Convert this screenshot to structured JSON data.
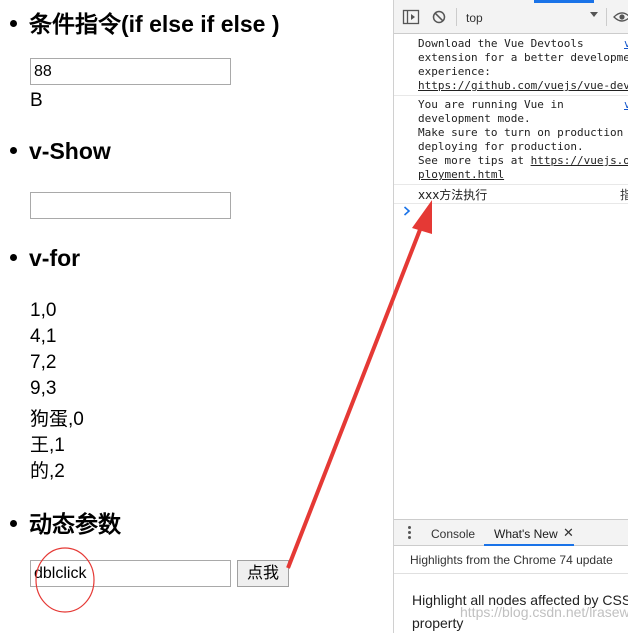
{
  "page": {
    "sections": [
      {
        "heading": "条件指令(if else if else )"
      },
      {
        "heading": "v-Show"
      },
      {
        "heading": "v-for"
      },
      {
        "heading": "动态参数"
      }
    ],
    "condition_input": {
      "value": "88"
    },
    "condition_result": "B",
    "vshow_input": {
      "value": ""
    },
    "vfor_items": [
      "1,0",
      "4,1",
      "7,2",
      "9,3",
      "狗蛋,0",
      "王,1",
      "的,2"
    ],
    "dynamic_input": {
      "value": "dblclick"
    },
    "click_button_label": "点我"
  },
  "devtools": {
    "context": "top",
    "messages": {
      "devtools_download": [
        "Download the Vue Devtools",
        "extension for a better developme",
        "experience:"
      ],
      "devtools_link": "https://github.com/vuejs/vue-dev",
      "dev_mode_lines": [
        "You are running Vue in",
        "development mode.",
        "Make sure to turn on production",
        "deploying for production.",
        "See more tips at "
      ],
      "dev_mode_link1": "https://vuejs.o",
      "dev_mode_link2": "ployment.html",
      "log_text": "xxx方法执行",
      "src_v1": "v",
      "src_v2": "v",
      "src_log": "指"
    },
    "drawer": {
      "tabs": [
        "Console",
        "What's New"
      ],
      "highlights": "Highlights from the Chrome 74 update",
      "whats_new_line1": "Highlight all nodes affected by CSS",
      "whats_new_line2": "property"
    },
    "icons": [
      "sidebar-toggle-icon",
      "clear-console-icon",
      "chevron-down-icon",
      "eye-icon"
    ],
    "accent_color": "#1a73e8"
  },
  "watermark": "https://blog.csdn.net/lrasewell",
  "annotation_color": "#e53935"
}
